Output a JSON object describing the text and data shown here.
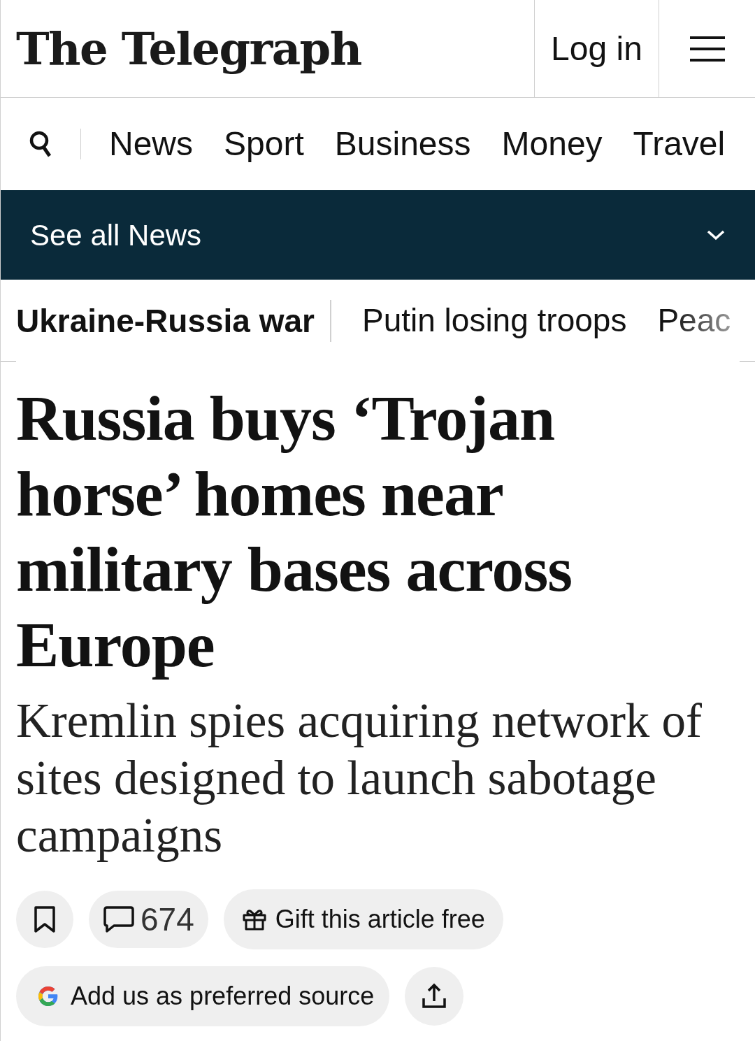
{
  "header": {
    "logo": "The Telegraph",
    "login": "Log in"
  },
  "nav": {
    "items": [
      {
        "label": "News"
      },
      {
        "label": "Sport"
      },
      {
        "label": "Business"
      },
      {
        "label": "Money"
      },
      {
        "label": "Travel"
      }
    ]
  },
  "section_bar": {
    "label": "See all News",
    "expanded": false
  },
  "topics": [
    {
      "label": "Ukraine-Russia war",
      "kind": "main"
    },
    {
      "label": "Putin losing troops",
      "kind": "link"
    },
    {
      "label": "Peac",
      "kind": "link"
    }
  ],
  "article": {
    "headline": "Russia buys ‘Trojan horse’ homes near military bases across Europe",
    "standfirst": "Kremlin spies acquiring network of sites designed to launch sabotage campaigns"
  },
  "actions": {
    "comments": "674",
    "gift": "Gift this article free",
    "preferred_source": "Add us as preferred source"
  }
}
